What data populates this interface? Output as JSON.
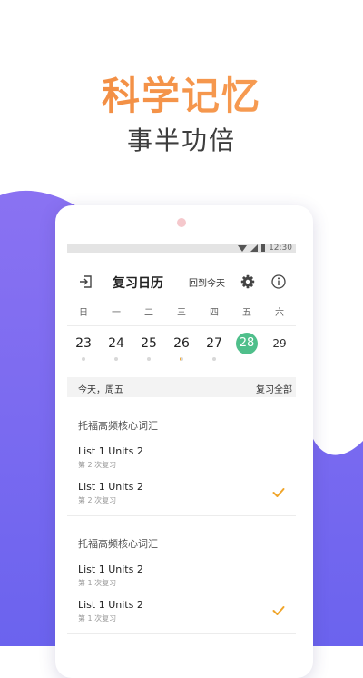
{
  "hero": {
    "title": "科学记忆",
    "subtitle": "事半功倍"
  },
  "statusbar": {
    "time": "12:30"
  },
  "appbar": {
    "title": "复习日历",
    "today_button": "回到今天"
  },
  "calendar": {
    "weekdays": [
      "日",
      "一",
      "二",
      "三",
      "四",
      "五",
      "六"
    ],
    "dates": [
      "23",
      "24",
      "25",
      "26",
      "27",
      "28",
      "29"
    ],
    "selected_date": "28"
  },
  "today_bar": {
    "label": "今天，周五",
    "review_all": "复习全部"
  },
  "groups": [
    {
      "title": "托福高频核心词汇",
      "items": [
        {
          "name": "List  1  Units 2",
          "sub": "第 2 次复习",
          "checked": false
        },
        {
          "name": "List  1  Units 2",
          "sub": "第 2 次复习",
          "checked": true
        }
      ]
    },
    {
      "title": "托福高频核心词汇",
      "items": [
        {
          "name": "List  1  Units 2",
          "sub": "第 1 次复习",
          "checked": false
        },
        {
          "name": "List  1  Units 2",
          "sub": "第 1 次复习",
          "checked": true
        }
      ]
    }
  ],
  "colors": {
    "accent_orange": "#f29a4a",
    "purple": "#7a6cf0",
    "selected_green": "#4fbf8b",
    "check_orange": "#f0a52a"
  }
}
